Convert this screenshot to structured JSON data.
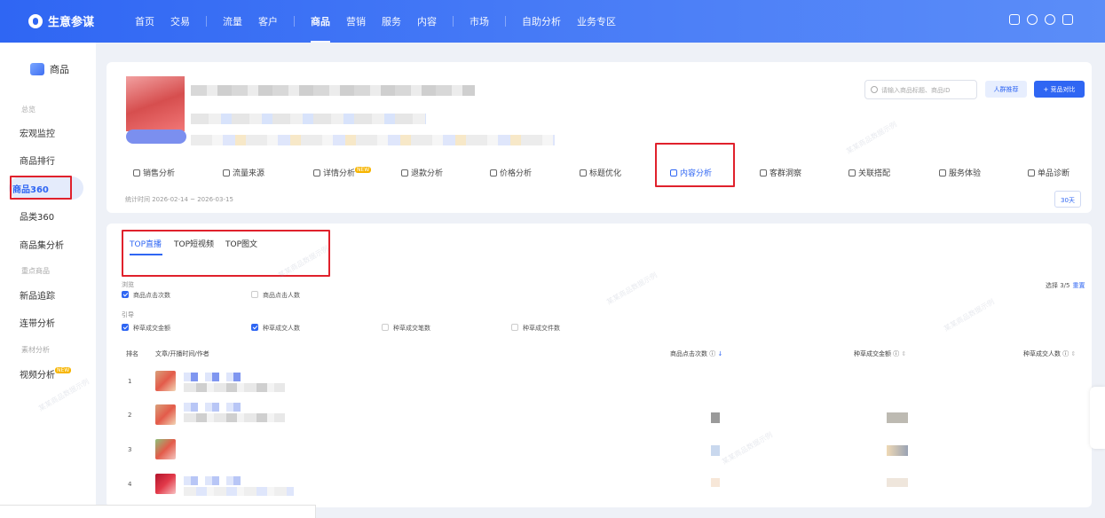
{
  "topbar": {
    "logo_text": "生意参谋",
    "nav": [
      "首页",
      "交易",
      "流量",
      "客户",
      "商品",
      "营销",
      "服务",
      "内容",
      "市场",
      "自助分析",
      "业务专区"
    ],
    "active_nav": "商品"
  },
  "sidebar": {
    "header": "商品",
    "groups": [
      "总览",
      "重点商品",
      "素材分析"
    ],
    "items": [
      "宏观监控",
      "商品排行",
      "商品360",
      "品类360",
      "商品集分析",
      "新品追踪",
      "连带分析",
      "视频分析"
    ],
    "new_badge": "NEW"
  },
  "product": {
    "search_placeholder": "请输入商品标题、商品ID",
    "crowd_button": "人群推荐",
    "compare_button": "+ 竞品对比"
  },
  "tabs": [
    "销售分析",
    "流量来源",
    "详情分析",
    "退款分析",
    "价格分析",
    "标题优化",
    "内容分析",
    "客群洞察",
    "关联搭配",
    "服务体验",
    "单品诊断"
  ],
  "active_tab": "内容分析",
  "stat": {
    "period": "统计时间 2026-02-14 ~ 2026-03-15",
    "days_button": "30天"
  },
  "subtabs": [
    "TOP直播",
    "TOP短视频",
    "TOP图文"
  ],
  "active_subtab": "TOP直播",
  "filters": {
    "browse_label": "浏览",
    "guide_label": "引导",
    "browse": [
      {
        "label": "商品点击次数",
        "checked": true
      },
      {
        "label": "商品点击人数",
        "checked": false
      }
    ],
    "guide": [
      {
        "label": "种草成交金额",
        "checked": true
      },
      {
        "label": "种草成交人数",
        "checked": true
      },
      {
        "label": "种草成交笔数",
        "checked": false
      },
      {
        "label": "种草成交件数",
        "checked": false
      }
    ],
    "selected": "选择 3/5",
    "reset": "重置"
  },
  "table": {
    "headers": [
      "排名",
      "文章/开播时间/作者",
      "商品点击次数",
      "种草成交金额",
      "种草成交人数"
    ],
    "rows": [
      {
        "rank": "1"
      },
      {
        "rank": "2"
      },
      {
        "rank": "3"
      },
      {
        "rank": "4"
      }
    ]
  },
  "watermark": "某某商品数据示例",
  "colors": {
    "brand": "#2f66f3",
    "highlight": "#e0212c"
  }
}
